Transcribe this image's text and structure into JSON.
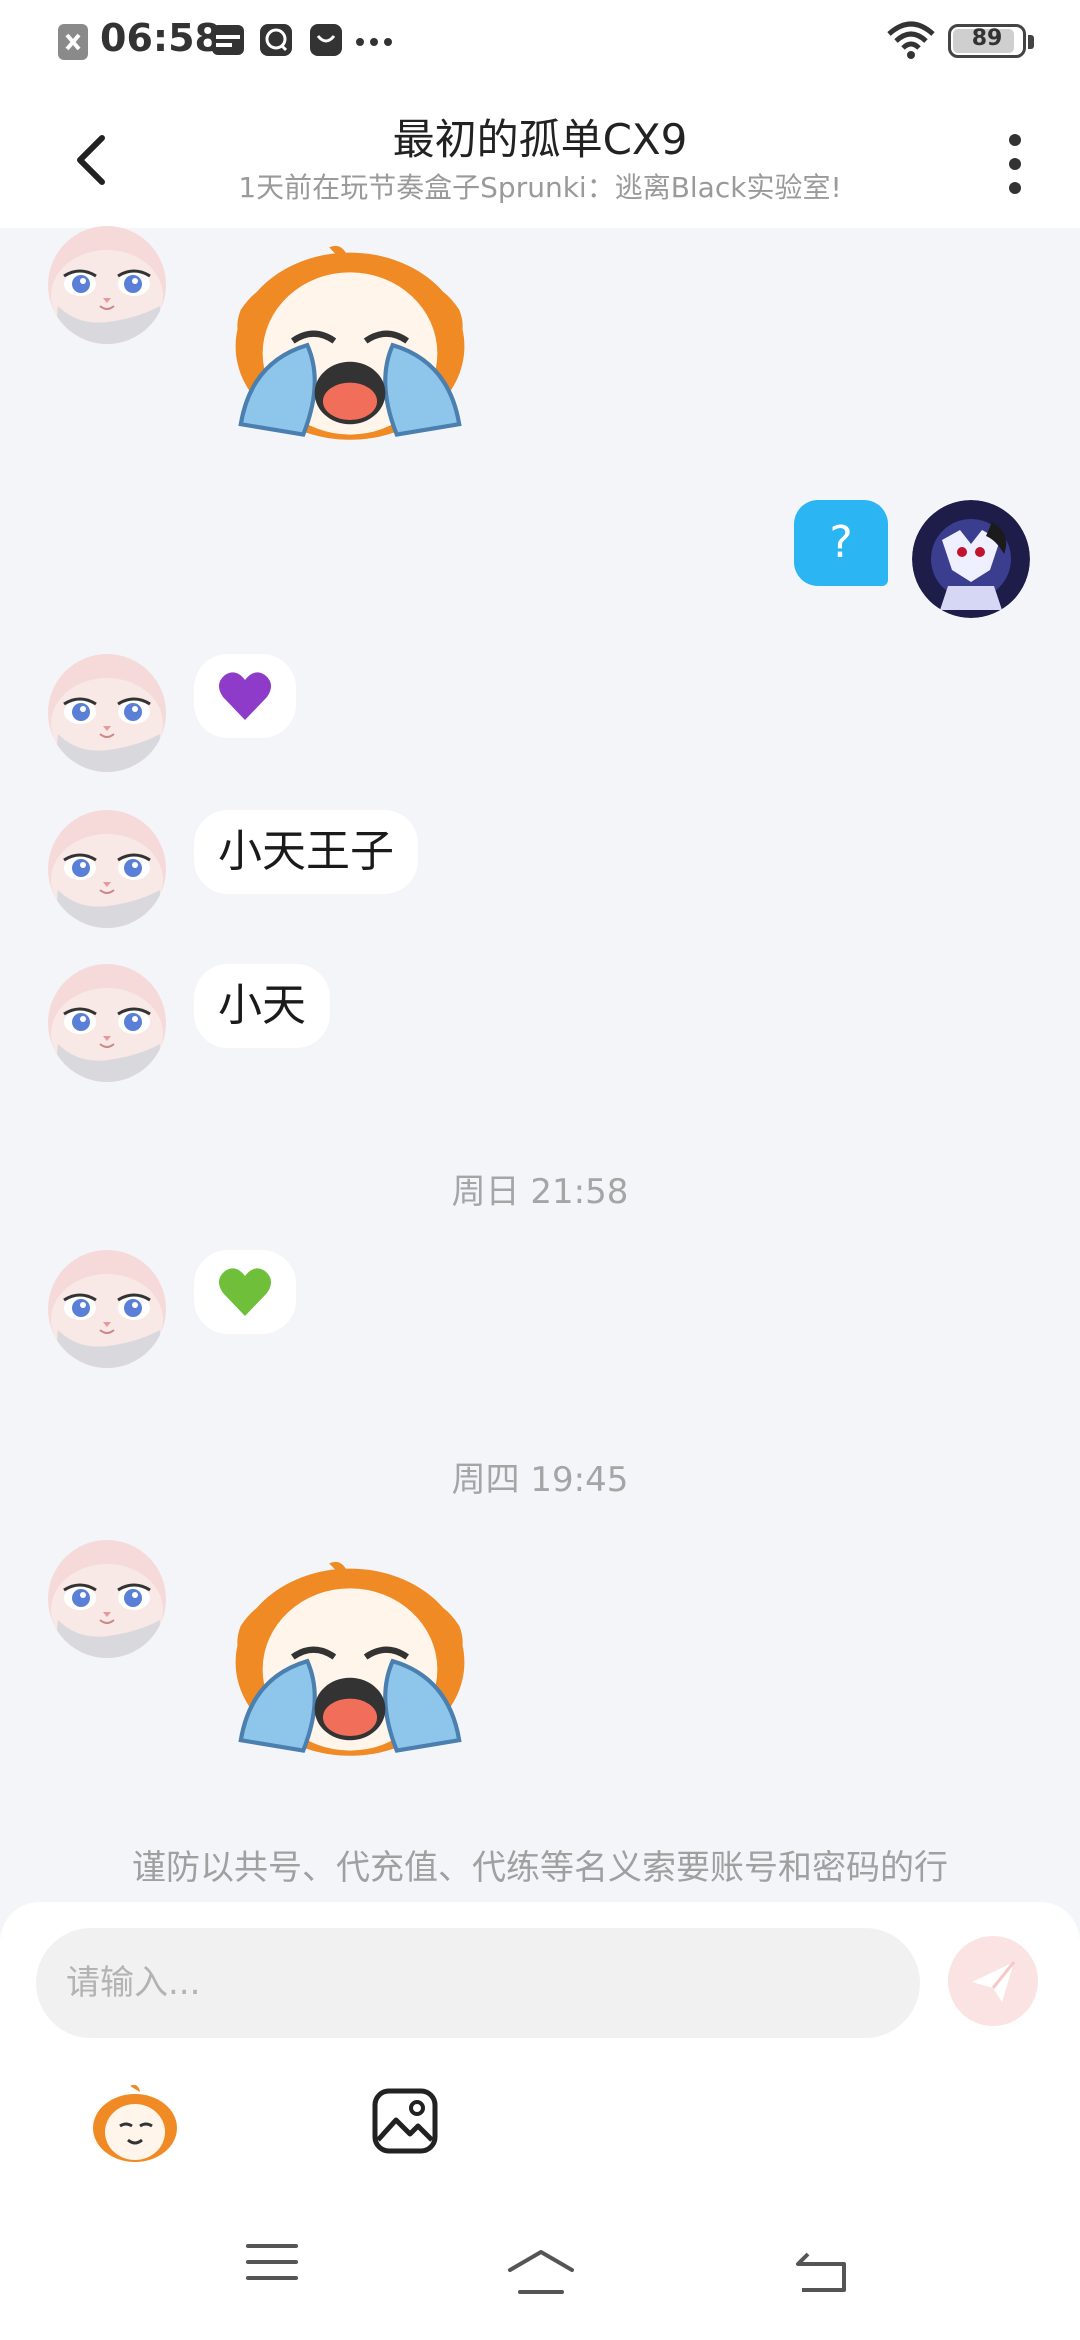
{
  "status_bar": {
    "time": "06:58",
    "battery": "89",
    "battery_level": 0.89,
    "icons": [
      "notification-close-icon",
      "card-icon",
      "chat-app-icon",
      "bag-icon",
      "more-dots-icon",
      "wifi-icon",
      "battery-icon"
    ]
  },
  "header": {
    "title": "最初的孤单CX9",
    "subtitle": "1天前在玩节奏盒子Sprunki：逃离Black实验室!"
  },
  "messages": {
    "question": "?",
    "purple_heart": "💜",
    "text1": "小天王子",
    "text2": "小天",
    "time1": "周日 21:58",
    "green_heart": "💚",
    "time2": "周四 19:45"
  },
  "warning": "谨防以共号、代充值、代练等名义索要账号和密码的行",
  "composer": {
    "placeholder": "请输入..."
  },
  "colors": {
    "accent": "#2bb6f3",
    "send": "#fbe3e3",
    "sticker_orange": "#f08a24",
    "tears": "#8ec5ea"
  }
}
